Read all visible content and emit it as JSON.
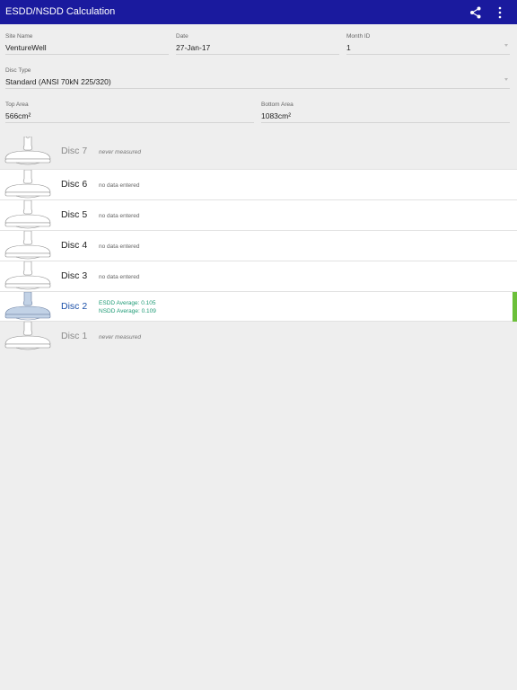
{
  "app": {
    "title": "ESDD/NSDD Calculation"
  },
  "icons": {
    "share": "share-icon",
    "more": "more-vert-icon"
  },
  "fields": {
    "site_name": {
      "label": "Site Name",
      "value": "VentureWell"
    },
    "date": {
      "label": "Date",
      "value": "27-Jan-17"
    },
    "month_id": {
      "label": "Month ID",
      "value": "1"
    },
    "disc_type": {
      "label": "Disc Type",
      "value": "Standard (ANSI 70kN 225/320)"
    },
    "top_area": {
      "label": "Top Area",
      "value": "566cm²"
    },
    "bottom_area": {
      "label": "Bottom Area",
      "value": "1083cm²"
    }
  },
  "discs": [
    {
      "name": "Disc 7",
      "status": "never measured"
    },
    {
      "name": "Disc 6",
      "status": "no data entered"
    },
    {
      "name": "Disc 5",
      "status": "no data entered"
    },
    {
      "name": "Disc 4",
      "status": "no data entered"
    },
    {
      "name": "Disc 3",
      "status": "no data entered"
    },
    {
      "name": "Disc 2",
      "esdd": "ESDD Average: 0.105",
      "nsdd": "NSDD Average: 0.109"
    },
    {
      "name": "Disc 1",
      "status": "never measured"
    }
  ],
  "colors": {
    "appbar": "#1a1a9e",
    "accent_text": "#1a4fa8",
    "average_text": "#1f9b76",
    "selected_indicator": "#6cc03a",
    "selected_fill": "#c2d2e6"
  }
}
